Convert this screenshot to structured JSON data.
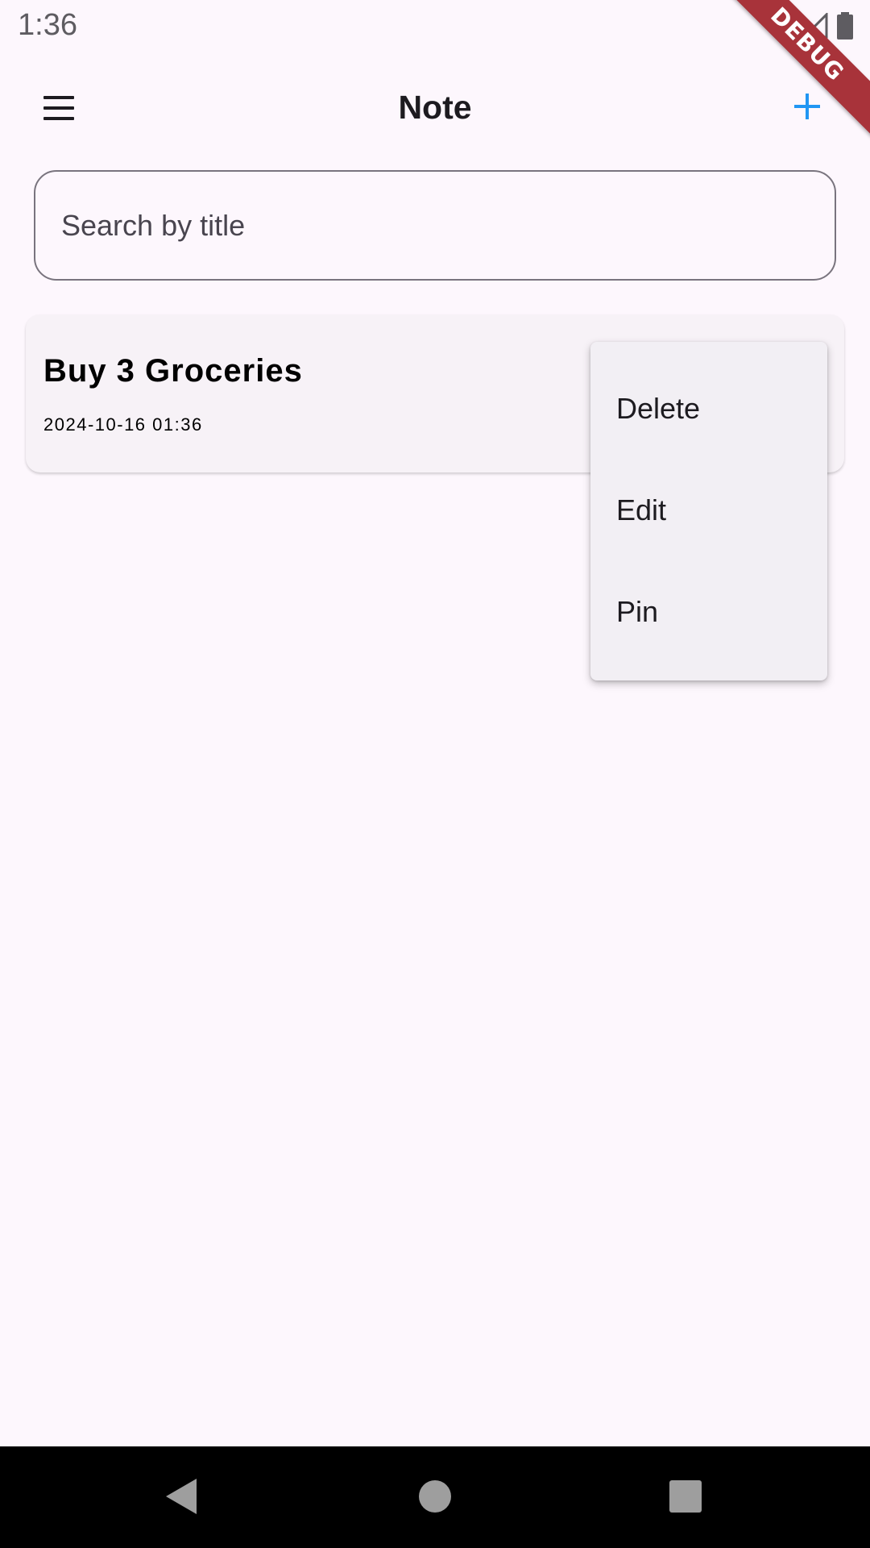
{
  "status_bar": {
    "time": "1:36",
    "icons": [
      "wifi-icon",
      "signal-icon",
      "battery-icon"
    ]
  },
  "debug_banner": "DEBUG",
  "app_bar": {
    "title": "Note",
    "menu_icon": "hamburger-menu-icon",
    "add_icon": "plus-icon",
    "accent_color": "#2196f3"
  },
  "search": {
    "placeholder": "Search by title",
    "value": ""
  },
  "notes": [
    {
      "title": "Buy 3 Groceries",
      "date": "2024-10-16 01:36"
    }
  ],
  "popup_menu": {
    "items": [
      {
        "label": "Delete"
      },
      {
        "label": "Edit"
      },
      {
        "label": "Pin"
      }
    ]
  },
  "nav_bar": {
    "buttons": [
      "back-icon",
      "home-icon",
      "recents-icon"
    ]
  }
}
